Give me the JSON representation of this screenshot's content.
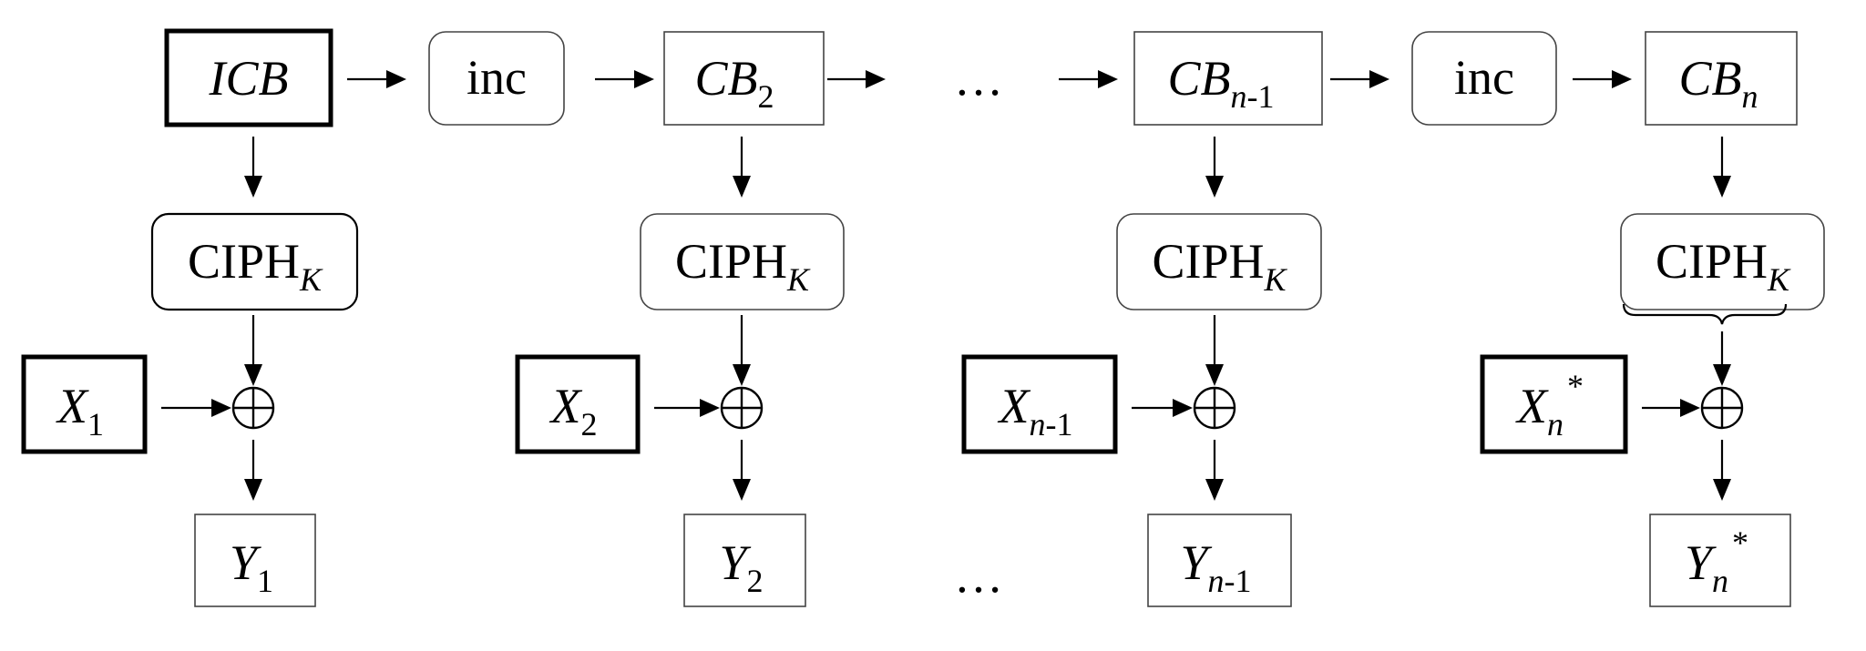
{
  "counter_blocks": [
    {
      "id": "icb",
      "main": "ICB",
      "sub": "",
      "emphasis": "thick"
    },
    {
      "id": "cb2",
      "main": "CB",
      "sub": "2",
      "emphasis": "thin"
    },
    {
      "id": "cbn1",
      "main": "CB",
      "sub": "n",
      "sub_suffix": "-1",
      "emphasis": "thin"
    },
    {
      "id": "cbn",
      "main": "CB",
      "sub": "n",
      "sub_suffix": "",
      "emphasis": "thin"
    }
  ],
  "inc_label": "inc",
  "cipher": {
    "main": "CIPH",
    "sub": "K"
  },
  "xor_symbol": "⊕",
  "ellipsis": "…",
  "inputs": [
    {
      "main": "X",
      "sub": "1",
      "sub_suffix": "",
      "sup": ""
    },
    {
      "main": "X",
      "sub": "2",
      "sub_suffix": "",
      "sup": ""
    },
    {
      "main": "X",
      "sub": "n",
      "sub_suffix": "-1",
      "sup": ""
    },
    {
      "main": "X",
      "sub": "n",
      "sub_suffix": "",
      "sup": "*"
    }
  ],
  "outputs": [
    {
      "main": "Y",
      "sub": "1",
      "sub_suffix": "",
      "sup": ""
    },
    {
      "main": "Y",
      "sub": "2",
      "sub_suffix": "",
      "sup": ""
    },
    {
      "main": "Y",
      "sub": "n",
      "sub_suffix": "-1",
      "sup": ""
    },
    {
      "main": "Y",
      "sub": "n",
      "sub_suffix": "",
      "sup": "*"
    }
  ]
}
